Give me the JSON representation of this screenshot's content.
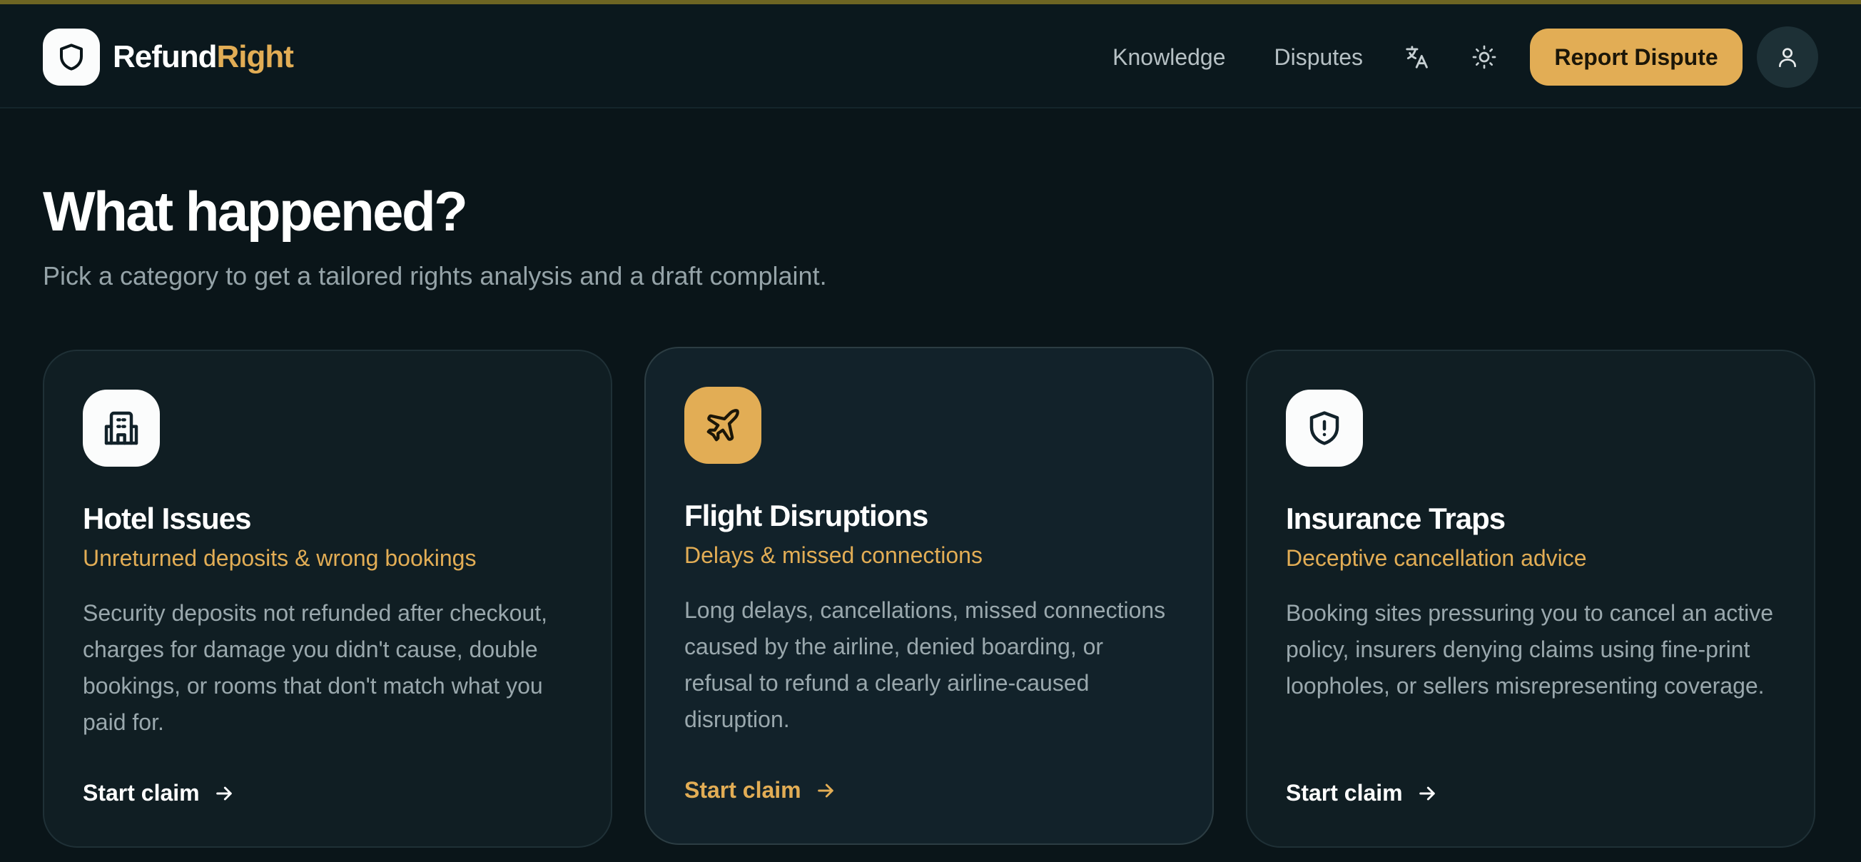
{
  "brand": {
    "name_part1": "Refund",
    "name_part2": "Right"
  },
  "nav": {
    "links": [
      "Knowledge",
      "Disputes"
    ],
    "icons": [
      "translate-icon",
      "sun-icon"
    ],
    "cta_label": "Report Dispute",
    "avatar_icon": "user-icon"
  },
  "hero": {
    "title": "What happened?",
    "subtitle": "Pick a category to get a tailored rights analysis and a draft complaint."
  },
  "cards": [
    {
      "icon": "hotel-icon",
      "title": "Hotel Issues",
      "tagline": "Unreturned deposits & wrong bookings",
      "description": "Security deposits not refunded after checkout, charges for damage you didn't cause, double bookings, or rooms that don't match what you paid for.",
      "link": "Start claim"
    },
    {
      "icon": "plane-icon",
      "title": "Flight Disruptions",
      "tagline": "Delays & missed connections",
      "description": "Long delays, cancellations, missed connections caused by the airline, denied boarding, or refusal to refund a clearly airline-caused disruption.",
      "link": "Start claim"
    },
    {
      "icon": "shield-alert-icon",
      "title": "Insurance Traps",
      "tagline": "Deceptive cancellation advice",
      "description": "Booking sites pressuring you to cancel an active policy, insurers denying claims using fine-print loopholes, or sellers misrepresenting coverage.",
      "link": "Start claim"
    }
  ],
  "colors": {
    "background": "#0a1519",
    "accent": "#e2ad55",
    "card": "#101e23",
    "muted_text": "#9aa8ad"
  }
}
